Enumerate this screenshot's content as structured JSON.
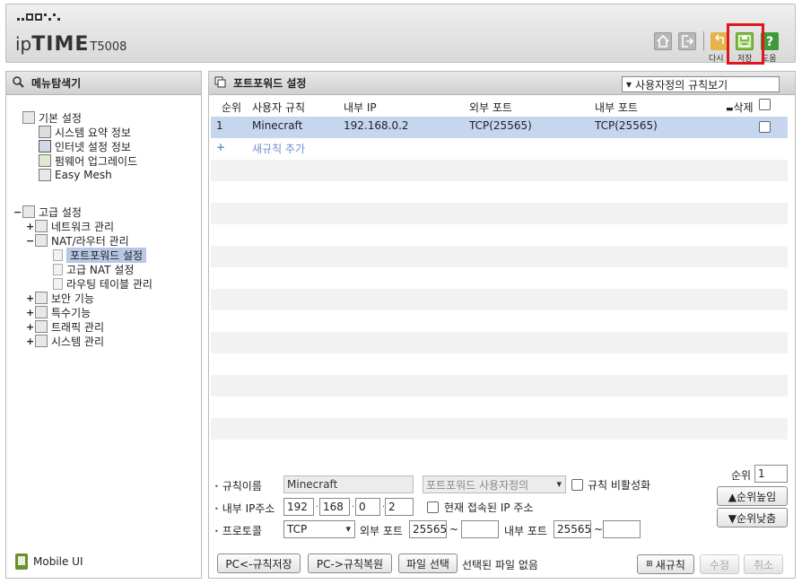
{
  "header": {
    "logo_ip": "ip",
    "logo_time": "TIME",
    "model": "T5008",
    "apply_label": "다시",
    "save_label": "저장",
    "help_label": "도움"
  },
  "sidebar": {
    "title": "메뉴탐색기",
    "basic": {
      "label": "기본 설정",
      "items": [
        "시스템 요약 정보",
        "인터넷 설정 정보",
        "펌웨어 업그레이드",
        "Easy Mesh"
      ]
    },
    "advanced": {
      "label": "고급 설정",
      "network": "네트워크 관리",
      "nat": "NAT/라우터 관리",
      "nat_items": [
        "포트포워드 설정",
        "고급 NAT 설정",
        "라우팅 테이블 관리"
      ],
      "others": [
        "보안 기능",
        "특수기능",
        "트래픽 관리",
        "시스템 관리"
      ]
    },
    "mobile_ui": "Mobile UI"
  },
  "main": {
    "title": "포트포워드 설정",
    "view_select": "사용자정의 규칙보기",
    "columns": {
      "rank": "순위",
      "rule_name": "사용자 규칙",
      "internal_ip": "내부 IP",
      "external_port": "외부 포트",
      "internal_port": "내부 포트",
      "delete": "삭제"
    },
    "rows": [
      {
        "rank": "1",
        "rule_name": "Minecraft",
        "internal_ip": "192.168.0.2",
        "external_port": "TCP(25565)",
        "internal_port": "TCP(25565)"
      }
    ],
    "add_rule": "새규칙 추가",
    "add_rule_plus": "+"
  },
  "form": {
    "rule_name_label": "규칙이름",
    "rule_name_value": "Minecraft",
    "type_select": "포트포워드 사용자정의",
    "disable_label": "규칙 비활성화",
    "rank_label": "순위",
    "rank_value": "1",
    "ip_label": "내부 IP주소",
    "ip": [
      "192",
      "168",
      "0",
      "2"
    ],
    "current_ip_label": "현재 접속된 IP 주소",
    "rank_up": "▲순위높임",
    "protocol_label": "프로토콜",
    "protocol_value": "TCP",
    "ext_port_label": "외부 포트",
    "ext_port_from": "25565",
    "ext_port_to": "",
    "int_port_label": "내부 포트",
    "int_port_from": "25565",
    "int_port_to": "",
    "tilde": "~",
    "rank_down": "▼순위낮춤",
    "pc_save": "PC<-규칙저장",
    "pc_restore": "PC->규칙복원",
    "file_select": "파일 선택",
    "no_file": "선택된 파일 없음",
    "new_rule": "새규칙",
    "modify": "수정",
    "cancel": "취소"
  }
}
